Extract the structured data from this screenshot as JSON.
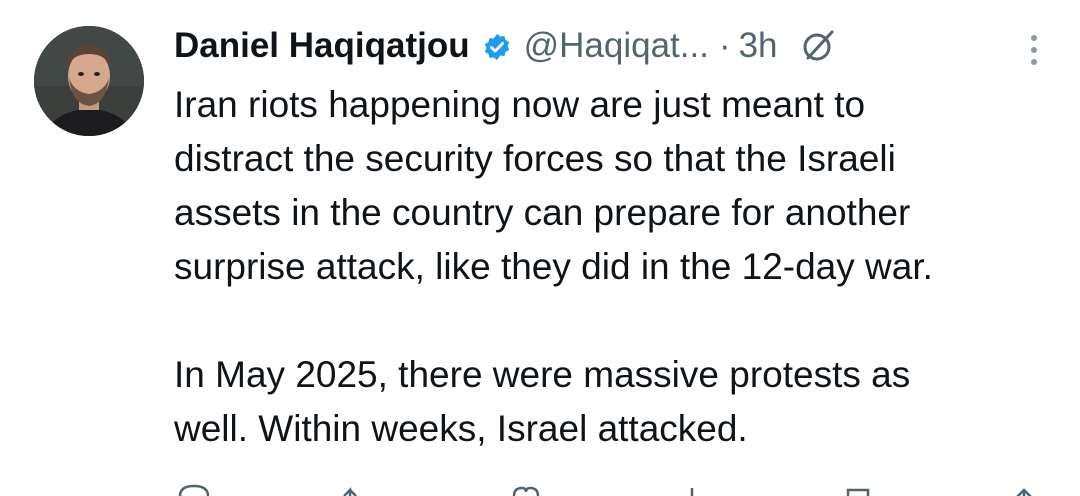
{
  "tweet": {
    "author_name": "Daniel Haqiqatjou",
    "handle": "@Haqiqat...",
    "separator": "·",
    "time": "3h",
    "paragraphs": [
      "Iran riots happening now are just meant to\ndistract the security forces so that the Israeli\nassets in the country can prepare for another\nsurprise attack, like they did in the 12-day war.",
      "In May 2025, there were massive protests as\nwell. Within weeks, Israel attacked."
    ]
  },
  "icons": {
    "verified": "verified-badge-icon",
    "grok": "grok-icon",
    "more": "more-vertical-icon",
    "reply": "reply-icon",
    "retweet": "retweet-icon",
    "like": "like-icon",
    "views": "views-icon",
    "bookmark": "bookmark-icon",
    "share": "share-icon"
  },
  "colors": {
    "text": "#0f1419",
    "secondary": "#536471",
    "verified": "#1d9bf0"
  }
}
